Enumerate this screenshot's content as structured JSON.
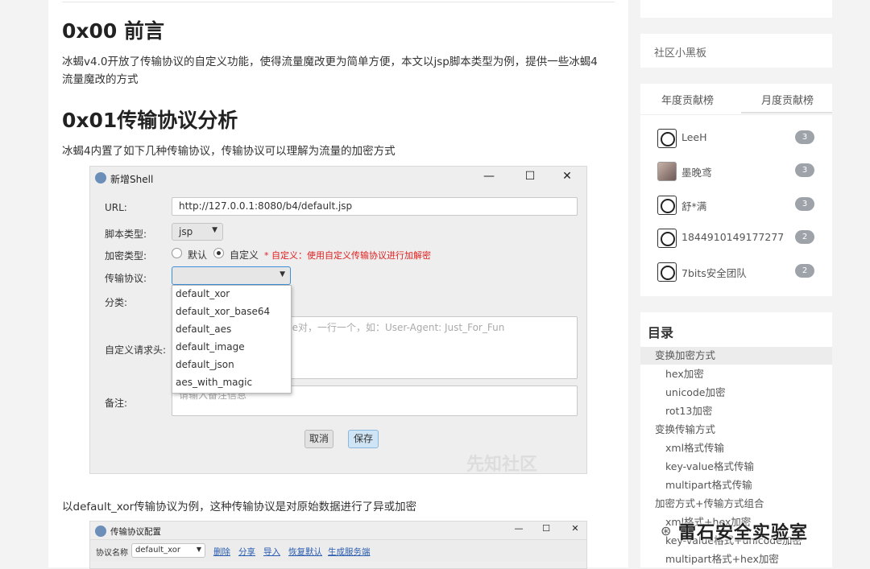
{
  "article": {
    "h1": "0x00 前言",
    "p1_line1": "冰蝎v4.0开放了传输协议的自定义功能，使得流量魔改更为简单方便，本文以jsp脚本类型为例，提供一些冰蝎4",
    "p1_line2": "流量魔改的方式",
    "h2": "0x01传输协议分析",
    "p2": "冰蝎4内置了如下几种传输协议，传输协议可以理解为流量的加密方式",
    "p3": "以default_xor传输协议为例，这种传输协议是对原始数据进行了异或加密"
  },
  "dialog": {
    "title": "新增Shell",
    "url_label": "URL:",
    "url_value": "http://127.0.0.1:8080/b4/default.jsp",
    "script_label": "脚本类型:",
    "script_value": "jsp",
    "enc_label": "加密类型:",
    "enc_default": "默认",
    "enc_custom": "自定义",
    "enc_hint": "* 自定义：使用自定义传输协议进行加解密",
    "proto_label": "传输协议:",
    "category_label": "分类:",
    "headers_label": "自定义请求头:",
    "headers_placeholder": "ue对，一行一个，如：User-Agent: Just_For_Fun",
    "notes_label": "备注:",
    "notes_placeholder": "请输入备注信息",
    "cancel": "取消",
    "save": "保存",
    "options": [
      "default_xor",
      "default_xor_base64",
      "default_aes",
      "default_image",
      "default_json",
      "aes_with_magic"
    ],
    "watermark": "先知社区"
  },
  "dialog2": {
    "title": "传输协议配置",
    "name_label": "协议名称",
    "name_value": "default_xor",
    "links": [
      "删除",
      "分享",
      "导入",
      "恢复默认",
      "生成服务端"
    ]
  },
  "sidebar": {
    "board": "社区小黑板",
    "tab_year": "年度贡献榜",
    "tab_month": "月度贡献榜",
    "ranks": [
      {
        "name": "LeeH",
        "count": "3"
      },
      {
        "name": "墨晚鸢",
        "count": "3"
      },
      {
        "name": "舒*满",
        "count": "3"
      },
      {
        "name": "1844910149177277",
        "count": "2"
      },
      {
        "name": "7bits安全团队",
        "count": "2"
      }
    ],
    "toc_title": "目录",
    "toc": [
      {
        "label": "变换加密方式",
        "level": 1
      },
      {
        "label": "hex加密",
        "level": 2
      },
      {
        "label": "unicode加密",
        "level": 2
      },
      {
        "label": "rot13加密",
        "level": 2
      },
      {
        "label": "变换传输方式",
        "level": 1
      },
      {
        "label": "xml格式传输",
        "level": 2
      },
      {
        "label": "key-value格式传输",
        "level": 2
      },
      {
        "label": "multipart格式传输",
        "level": 2
      },
      {
        "label": "加密方式+传输方式组合",
        "level": 1
      },
      {
        "label": "xml格式+hex加密",
        "level": 2
      },
      {
        "label": "key-value格式+unicode加密",
        "level": 2
      },
      {
        "label": "multipart格式+hex加密",
        "level": 2
      }
    ]
  },
  "overlay": {
    "wechat": "雷石安全实验室"
  }
}
